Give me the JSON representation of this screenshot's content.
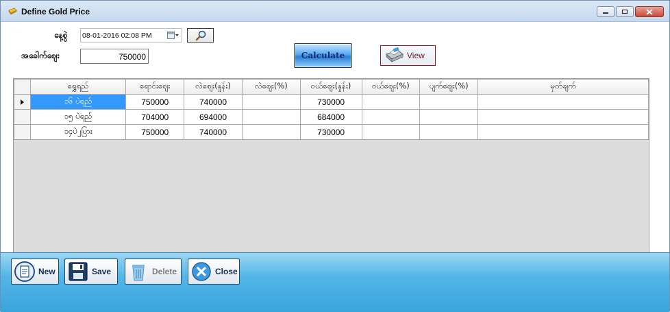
{
  "window": {
    "title": "Define Gold Price"
  },
  "form": {
    "date_label": "နေ့စွဲ",
    "date_value": "08-01-2016 02:08 PM",
    "base_price_label": "အခေါက်ဈေး",
    "base_price_value": "750000",
    "calculate_label": "Calculate",
    "view_label": "View"
  },
  "grid": {
    "columns": [
      "ရွှေရည်",
      "ရောင်းဈေး",
      "လဲဈေး(နှုန်း)",
      "လဲဈေး(%)",
      "ဝယ်ဈေး(နှုန်း)",
      "ဝယ်ဈေး(%)",
      "ပျက်ဈေး(%)",
      "မှတ်ချက်"
    ],
    "rows": [
      {
        "c0": "၁၆ ပဲရည်",
        "c1": "750000",
        "c2": "740000",
        "c3": "",
        "c4": "730000",
        "c5": "",
        "c6": "",
        "c7": "",
        "current": true
      },
      {
        "c0": "၁၅ ပဲရည်",
        "c1": "704000",
        "c2": "694000",
        "c3": "",
        "c4": "684000",
        "c5": "",
        "c6": "",
        "c7": "",
        "current": false
      },
      {
        "c0": "၁၄ပဲ၂ပြား",
        "c1": "750000",
        "c2": "740000",
        "c3": "",
        "c4": "730000",
        "c5": "",
        "c6": "",
        "c7": "",
        "current": false
      }
    ]
  },
  "footer": {
    "new_label": "New",
    "save_label": "Save",
    "delete_label": "Delete",
    "close_label": "Close"
  },
  "colors": {
    "accent": "#3399ff",
    "footer_bar": "#53b5e6",
    "calculate_button": "#2a7fd6"
  }
}
